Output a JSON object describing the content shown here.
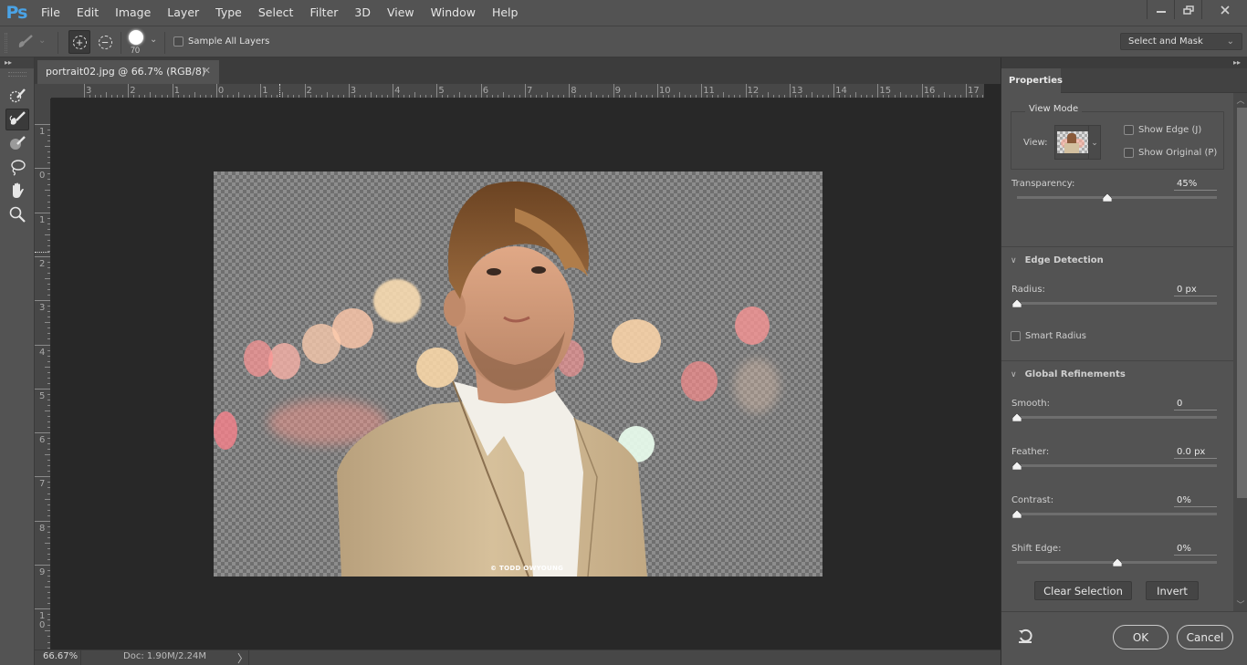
{
  "app": {
    "logo": "Ps",
    "menu": [
      "File",
      "Edit",
      "Image",
      "Layer",
      "Type",
      "Select",
      "Filter",
      "3D",
      "View",
      "Window",
      "Help"
    ],
    "window_controls": {
      "minimize": "minimize-icon",
      "restore": "restore-icon",
      "close": "close-icon"
    }
  },
  "options_bar": {
    "tool_icon": "refine-edge-brush-icon",
    "mode_add": "add-to-selection-icon",
    "mode_subtract": "subtract-from-selection-icon",
    "brush_size": "70",
    "sample_all_layers_label": "Sample All Layers",
    "sample_all_layers_checked": false,
    "select_and_mask_dropdown": "Select and Mask"
  },
  "toolbar": {
    "tools": [
      {
        "name": "quick-selection-tool",
        "active": false
      },
      {
        "name": "refine-edge-brush-tool",
        "active": true
      },
      {
        "name": "brush-tool",
        "active": false
      },
      {
        "name": "lasso-tool",
        "active": false
      },
      {
        "name": "hand-tool",
        "active": false
      },
      {
        "name": "zoom-tool",
        "active": false
      }
    ]
  },
  "document": {
    "tab_title": "portrait02.jpg @ 66.7% (RGB/8)",
    "close_glyph": "✕",
    "image_credit": "© TODD OWYOUNG"
  },
  "rulers": {
    "horizontal": [
      "3",
      "2",
      "1",
      "0",
      "1",
      "2",
      "3",
      "4",
      "5",
      "6",
      "7",
      "8",
      "9",
      "10",
      "11",
      "12",
      "13",
      "14",
      "15",
      "16",
      "17"
    ],
    "vertical": [
      "1",
      "0",
      "1",
      "2",
      "3",
      "4",
      "5",
      "6",
      "7",
      "8",
      "9",
      "1\n0"
    ]
  },
  "status": {
    "zoom": "66.67%",
    "doc_info": "Doc: 1.90M/2.24M",
    "arrow": "〉"
  },
  "properties": {
    "tab": "Properties",
    "view_mode": {
      "legend": "View Mode",
      "view_label": "View:",
      "show_edge_label": "Show Edge (J)",
      "show_edge_checked": false,
      "show_original_label": "Show Original (P)",
      "show_original_checked": false
    },
    "transparency": {
      "label": "Transparency:",
      "value": "45%",
      "fraction": 0.45
    },
    "edge_detection": {
      "title": "Edge Detection",
      "radius": {
        "label": "Radius:",
        "value": "0 px",
        "fraction": 0
      },
      "smart_radius_label": "Smart Radius",
      "smart_radius_checked": false
    },
    "global_refinements": {
      "title": "Global Refinements",
      "smooth": {
        "label": "Smooth:",
        "value": "0",
        "fraction": 0
      },
      "feather": {
        "label": "Feather:",
        "value": "0.0 px",
        "fraction": 0
      },
      "contrast": {
        "label": "Contrast:",
        "value": "0%",
        "fraction": 0
      },
      "shift_edge": {
        "label": "Shift Edge:",
        "value": "0%",
        "fraction": 0.5
      }
    },
    "buttons": {
      "clear_selection": "Clear Selection",
      "invert": "Invert"
    },
    "footer": {
      "ok": "OK",
      "cancel": "Cancel",
      "reset_icon": "reset-icon"
    }
  },
  "colors": {
    "ps_blue": "#4aa3e6",
    "panel": "#535353",
    "canvas": "#282828"
  }
}
